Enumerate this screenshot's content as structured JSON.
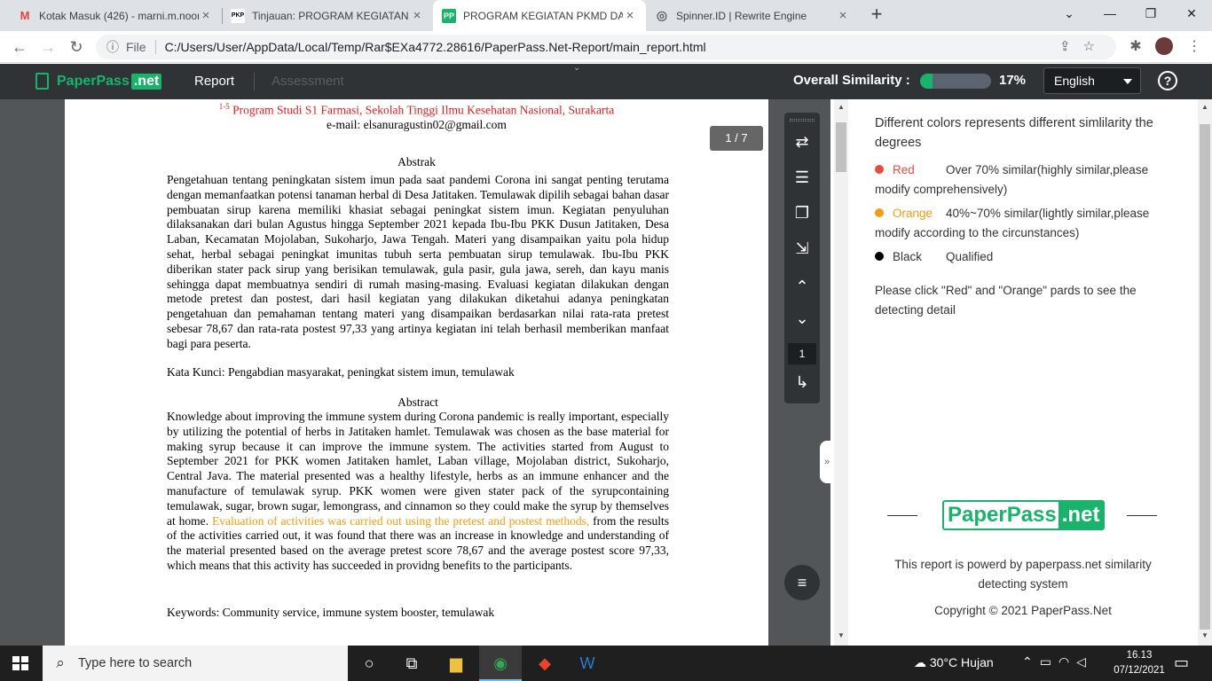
{
  "browser": {
    "tabs": [
      {
        "favicon": "M",
        "title": "Kotak Masuk (426) - marni.m.noor",
        "close": "×"
      },
      {
        "favicon": "PKP",
        "title": "Tinjauan: PROGRAM KEGIATAN PKMD",
        "close": "×"
      },
      {
        "favicon": "PP",
        "title": "PROGRAM KEGIATAN PKMD DALAM",
        "close": "×"
      },
      {
        "favicon": "◎",
        "title": "Spinner.ID | Rewrite Engine",
        "close": "×"
      }
    ],
    "new_tab": "+",
    "window": {
      "dropdown": "⌄",
      "minimize": "—",
      "restore": "❐",
      "close": "✕"
    },
    "nav": {
      "back": "←",
      "forward": "→",
      "reload": "↻"
    },
    "address": {
      "info_icon": "ⓘ",
      "scheme": "File",
      "url": "C:/Users/User/AppData/Local/Temp/Rar$EXa4772.28616/PaperPass.Net-Report/main_report.html",
      "right_icons": "⇪☆"
    },
    "extensions": {
      "puzzle": "✱",
      "menu": "⋮"
    }
  },
  "app": {
    "brand": {
      "name": "PaperPass",
      "tld": ".net"
    },
    "nav": {
      "report": "Report",
      "assessment": "Assessment",
      "chevron": "⌄"
    },
    "similarity": {
      "label": "Overall Similarity :",
      "value": "17%",
      "level": 0.17
    },
    "language": "English",
    "help": "?"
  },
  "document": {
    "affiliation_sup": "1-5",
    "affiliation": " Program Studi S1 Farmasi, Sekolah Tinggi  Ilmu Kesehatan Nasional, Surakarta",
    "email": "e-mail: elsanuragustin02@gmail.com",
    "abstrak_heading": "Abstrak",
    "abstrak_body": "Pengetahuan tentang peningkatan sistem imun pada saat pandemi Corona ini sangat penting terutama dengan memanfaatkan potensi tanaman herbal di Desa Jatitaken. Temulawak dipilih sebagai bahan dasar pembuatan sirup karena memiliki khasiat sebagai peningkat sistem imun. Kegiatan penyuluhan dilaksanakan dari bulan Agustus hingga September 2021 kepada Ibu-Ibu PKK Dusun Jatitaken, Desa Laban, Kecamatan Mojolaban, Sukoharjo, Jawa Tengah. Materi yang disampaikan yaitu pola hidup sehat, herbal sebagai peningkat imunitas tubuh serta pembuatan sirup temulawak. Ibu-Ibu PKK diberikan stater pack sirup yang berisikan temulawak, gula pasir, gula jawa, sereh, dan kayu manis sehingga dapat membuatnya sendiri di rumah masing-masing. Evaluasi kegiatan dilakukan dengan metode pretest dan postest, dari hasil kegiatan yang dilakukan diketahui adanya peningkatan pengetahuan dan pemahaman tentang materi yang disampaikan berdasarkan nilai rata-rata pretest sebesar 78,67 dan rata-rata postest 97,33 yang artinya kegiatan ini telah berhasil memberikan manfaat bagi para peserta.",
    "kata_kunci": "Kata Kunci: Pengabdian masyarakat, peningkat sistem imun, temulawak",
    "abstract_heading": "Abstract",
    "abstract_body_1": "Knowledge about improving the immune system during Corona pandemic is really important, especially by utilizing the potential of herbs in Jatitaken hamlet. Temulawak was chosen as the base material for making syrup because it can improve the immune system. The activities started from August to September 2021 for PKK women Jatitaken hamlet, Laban village, Mojolaban district, Sukoharjo, Central Java. The material presented was a healthy lifestyle, herbs as an immune enhancer and the manufacture of temulawak syrup. PKK women were given stater pack of the syrupcontaining temulawak, sugar, brown sugar, lemongrass, and cinnamon so they could make the syrup by themselves at home. ",
    "abstract_highlight": "Evaluation of activities was carried out using the pretest and postest methods,",
    "abstract_body_2": " from the results of the activities carried out, it was found that there was an increase in knowledge and understanding of the material presented based on the average pretest score 78,67 and the average postest score 97,33, which means that this activity has succeeded in providng benefits to the participants.",
    "keywords": "Keywords: Community service, immune system booster, temulawak"
  },
  "viewer": {
    "page_badge": "1 / 7",
    "tools": {
      "swap": "⇄",
      "list": "☰",
      "copy": "❐",
      "fit": "⇲",
      "up": "⌃",
      "down": "⌄",
      "goto": "↳"
    },
    "page_input": "1",
    "menu": "≡",
    "collapse": "»"
  },
  "side": {
    "heading": "Different colors represents different simlilarity the degrees",
    "legend": [
      {
        "name": "Red",
        "desc": "Over 70% similar(highly similar,please modify comprehensively)",
        "color": "#e74c3c"
      },
      {
        "name": "Orange",
        "desc": "40%~70% similar(lightly similar,please modify according to the circunstances)",
        "color": "#f39c12"
      },
      {
        "name": "Black",
        "desc": "Qualified",
        "color": "#000000"
      }
    ],
    "note": "Please click \"Red\" and \"Orange\" pards to see the detecting detail",
    "brand": {
      "name": "PaperPass",
      "tld": ".net"
    },
    "powered": "This report is powerd by paperpass.net similarity detecting system",
    "copyright": "Copyright © 2021 PaperPass.Net"
  },
  "taskbar": {
    "search_placeholder": "Type here to search",
    "weather": "30°C  Hujan",
    "tray": "⌃▭◠◁",
    "time": "16.13",
    "date": "07/12/2021"
  }
}
